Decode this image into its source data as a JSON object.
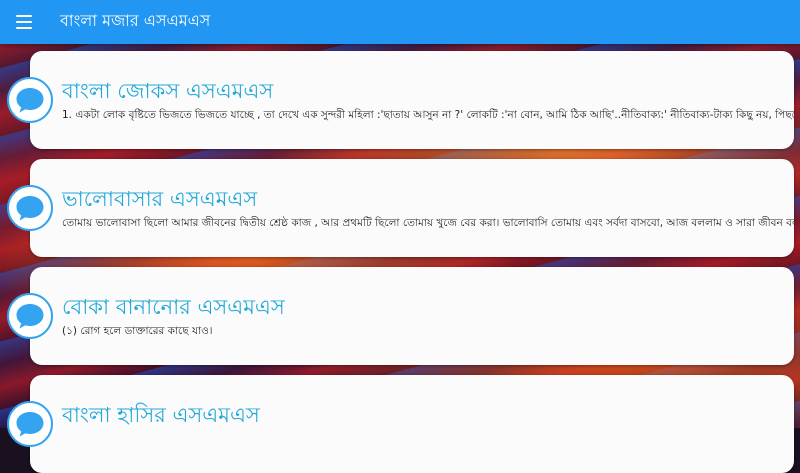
{
  "app": {
    "title": "বাংলা মজার এসএমএস",
    "menu_icon": "hamburger-menu-icon",
    "bar_color": "#2196f3"
  },
  "categories": [
    {
      "title": "বাংলা জোকস এসএমএস",
      "preview": "1. একটা লোক বৃষ্টিতে ভিজতে ভিজতে যাচ্ছে , তা দেখে এক সুন্দরী মহিলা :'ছাতায় আসুন না ?' লোকটি :'না বোন, আমি ঠিক আছি'..নীতিবাক্য:' নীতিবাক্য-টাক্য কিছু নয়, পিছনে",
      "icon": "chat-bubble-icon"
    },
    {
      "title": "ভালোবাসার এসএমএস",
      "preview": "তোমায় ভালোবাসা ছিলো আমার জীবনের দ্বিতীয় শ্রেষ্ঠ কাজ , আর প্রথমটি ছিলো তোমায় খুজে বের করা। ভালোবাসি তোমায় এবং সর্বদা বাসবো, আজ বললাম ও সারা জীবন বলবো",
      "icon": "chat-bubble-icon"
    },
    {
      "title": "বোকা বানানোর এসএমএস",
      "preview": "(১) রোগ হলে ডাক্তারের কাছে যাও।",
      "icon": "chat-bubble-icon"
    },
    {
      "title": "বাংলা হাসির এসএমএস",
      "preview": "",
      "icon": "chat-bubble-icon"
    }
  ],
  "colors": {
    "title_accent": "#1fa8d8",
    "icon_accent": "#34a3f0"
  }
}
